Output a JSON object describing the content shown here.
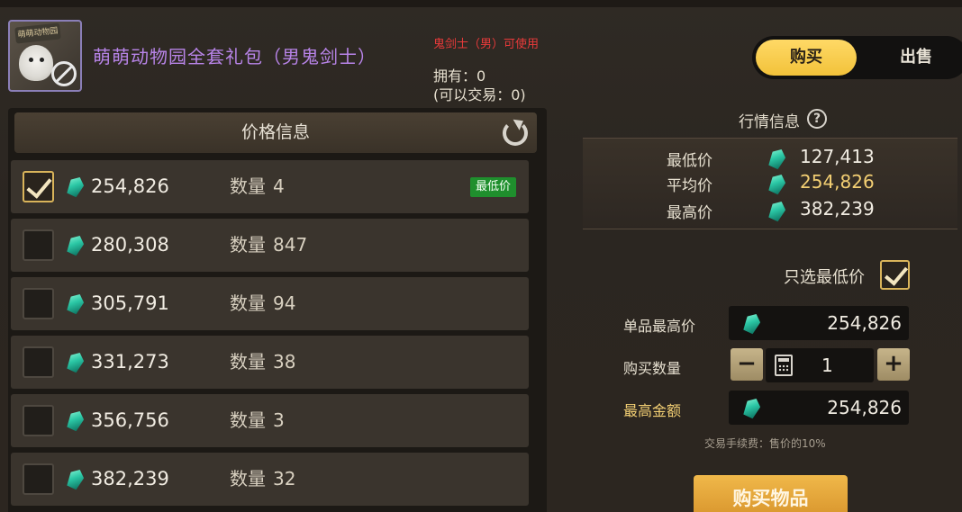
{
  "item": {
    "name": "萌萌动物园全套礼包（男鬼剑士）",
    "icon_poster_text": "萌萌动物园",
    "usable_by": "鬼剑士（男）可使用",
    "owned": "拥有：0",
    "tradeable": "(可以交易：0)"
  },
  "tabs": {
    "buy": "购买",
    "sell": "出售",
    "active": "buy"
  },
  "price_panel": {
    "title": "价格信息",
    "qty_label": "数量",
    "lowest_badge": "最低价",
    "rows": [
      {
        "price": "254,826",
        "qty": "4",
        "checked": true,
        "badge": true
      },
      {
        "price": "280,308",
        "qty": "847",
        "checked": false,
        "badge": false
      },
      {
        "price": "305,791",
        "qty": "94",
        "checked": false,
        "badge": false
      },
      {
        "price": "331,273",
        "qty": "38",
        "checked": false,
        "badge": false
      },
      {
        "price": "356,756",
        "qty": "3",
        "checked": false,
        "badge": false
      },
      {
        "price": "382,239",
        "qty": "32",
        "checked": false,
        "badge": false
      }
    ]
  },
  "market": {
    "title": "行情信息",
    "help": "?",
    "lowest_label": "最低价",
    "lowest_value": "127,413",
    "avg_label": "平均价",
    "avg_value": "254,826",
    "highest_label": "最高价",
    "highest_value": "382,239"
  },
  "order": {
    "only_lowest_label": "只选最低价",
    "only_lowest_checked": true,
    "max_unit_label": "单品最高价",
    "max_unit_value": "254,826",
    "buy_qty_label": "购买数量",
    "buy_qty_value": "1",
    "minus": "−",
    "plus": "+",
    "max_total_label": "最高金额",
    "max_total_value": "254,826",
    "fee_note": "交易手续费：售价的10%",
    "buy_button": "购买物品"
  },
  "colors": {
    "accent_gold": "#f2c23a",
    "item_name_purple": "#b884e8",
    "warning_red": "#e83a3a",
    "badge_green": "#1f8f2d",
    "gem_teal": "#2bc7a5"
  },
  "icons": [
    "item-icon",
    "no-trade-icon",
    "refresh-icon",
    "gem-icon",
    "help-icon",
    "checkbox-icon",
    "calculator-icon"
  ]
}
